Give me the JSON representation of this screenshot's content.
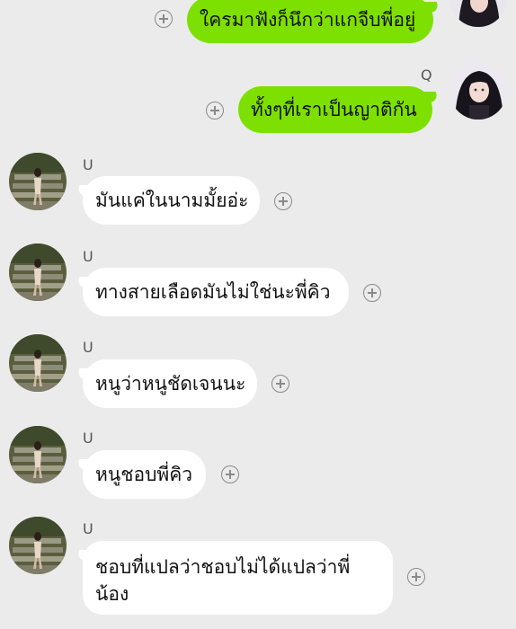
{
  "messages": [
    {
      "id": "m1",
      "direction": "outgoing",
      "sender": "",
      "text": "ใครมาฟังก็นึกว่าแกจีบพี่อยู่"
    },
    {
      "id": "m2",
      "direction": "outgoing",
      "sender": "Q",
      "text": "ทั้งๆที่เราเป็นญาติกัน"
    },
    {
      "id": "m3",
      "direction": "incoming",
      "sender": "U",
      "text": "มันแค่ในนามมั้ยอ่ะ"
    },
    {
      "id": "m4",
      "direction": "incoming",
      "sender": "U",
      "text": "ทางสายเลือดมันไม่ใช่นะพี่คิว"
    },
    {
      "id": "m5",
      "direction": "incoming",
      "sender": "U",
      "text": "หนูว่าหนูชัดเจนนะ"
    },
    {
      "id": "m6",
      "direction": "incoming",
      "sender": "U",
      "text": "หนูชอบพี่คิว"
    },
    {
      "id": "m7",
      "direction": "incoming",
      "sender": "U",
      "text": "ชอบที่แปลว่าชอบไม่ได้แปลว่าพี่น้อง"
    }
  ],
  "icons": {
    "add": "plus-circle-icon",
    "avatar_q": "profile-avatar-q",
    "avatar_u": "profile-avatar-u"
  },
  "colors": {
    "background": "#ebebeb",
    "outgoing_bubble": "#7ee000",
    "incoming_bubble": "#ffffff",
    "text": "#111111",
    "icon": "#8a8a8a"
  }
}
